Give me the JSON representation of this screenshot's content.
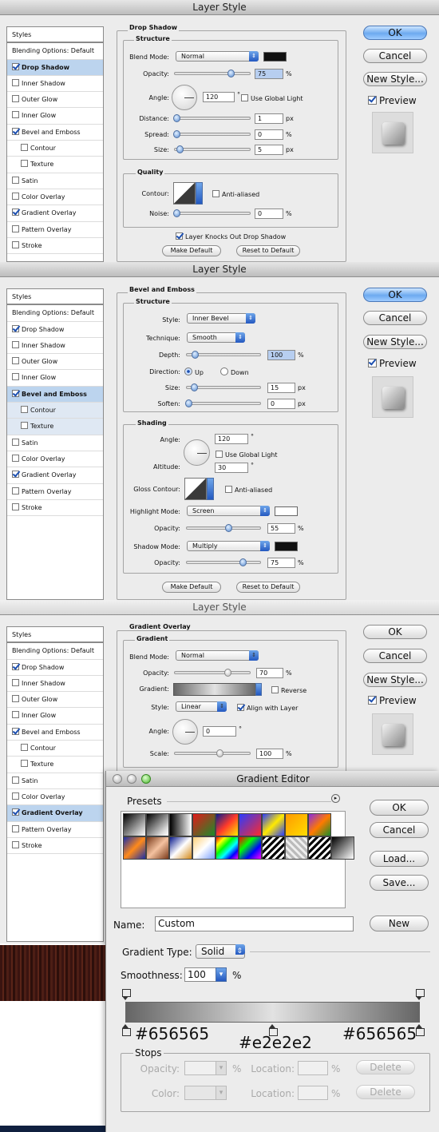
{
  "panel1": {
    "title": "Layer Style",
    "styles_header": "Styles",
    "styles": [
      {
        "label": "Blending Options: Default",
        "check": null,
        "indent": false,
        "state": ""
      },
      {
        "label": "Drop Shadow",
        "check": true,
        "indent": false,
        "state": "sel"
      },
      {
        "label": "Inner Shadow",
        "check": false,
        "indent": false,
        "state": ""
      },
      {
        "label": "Outer Glow",
        "check": false,
        "indent": false,
        "state": ""
      },
      {
        "label": "Inner Glow",
        "check": false,
        "indent": false,
        "state": ""
      },
      {
        "label": "Bevel and Emboss",
        "check": true,
        "indent": false,
        "state": ""
      },
      {
        "label": "Contour",
        "check": false,
        "indent": true,
        "state": ""
      },
      {
        "label": "Texture",
        "check": false,
        "indent": true,
        "state": ""
      },
      {
        "label": "Satin",
        "check": false,
        "indent": false,
        "state": ""
      },
      {
        "label": "Color Overlay",
        "check": false,
        "indent": false,
        "state": ""
      },
      {
        "label": "Gradient Overlay",
        "check": true,
        "indent": false,
        "state": ""
      },
      {
        "label": "Pattern Overlay",
        "check": false,
        "indent": false,
        "state": ""
      },
      {
        "label": "Stroke",
        "check": false,
        "indent": false,
        "state": ""
      }
    ],
    "section_title": "Drop Shadow",
    "structure_title": "Structure",
    "blend_mode_label": "Blend Mode:",
    "blend_mode": "Normal",
    "blend_color": "#111111",
    "opacity_label": "Opacity:",
    "opacity": "75",
    "opacity_unit": "%",
    "angle_label": "Angle:",
    "angle": "120",
    "angle_unit": "°",
    "global_light": "Use Global Light",
    "distance_label": "Distance:",
    "distance": "1",
    "distance_unit": "px",
    "spread_label": "Spread:",
    "spread": "0",
    "spread_unit": "%",
    "size_label": "Size:",
    "size": "5",
    "size_unit": "px",
    "quality_title": "Quality",
    "contour_label": "Contour:",
    "anti_aliased": "Anti-aliased",
    "noise_label": "Noise:",
    "noise": "0",
    "noise_unit": "%",
    "knockout": "Layer Knocks Out Drop Shadow",
    "make_default": "Make Default",
    "reset_default": "Reset to Default",
    "ok": "OK",
    "cancel": "Cancel",
    "new_style": "New Style...",
    "preview": "Preview"
  },
  "panel2": {
    "title": "Layer Style",
    "styles_header": "Styles",
    "styles": [
      {
        "label": "Blending Options: Default",
        "check": null,
        "indent": false,
        "state": ""
      },
      {
        "label": "Drop Shadow",
        "check": true,
        "indent": false,
        "state": ""
      },
      {
        "label": "Inner Shadow",
        "check": false,
        "indent": false,
        "state": ""
      },
      {
        "label": "Outer Glow",
        "check": false,
        "indent": false,
        "state": ""
      },
      {
        "label": "Inner Glow",
        "check": false,
        "indent": false,
        "state": ""
      },
      {
        "label": "Bevel and Emboss",
        "check": true,
        "indent": false,
        "state": "sel"
      },
      {
        "label": "Contour",
        "check": false,
        "indent": true,
        "state": "sel2"
      },
      {
        "label": "Texture",
        "check": false,
        "indent": true,
        "state": "sel2"
      },
      {
        "label": "Satin",
        "check": false,
        "indent": false,
        "state": ""
      },
      {
        "label": "Color Overlay",
        "check": false,
        "indent": false,
        "state": ""
      },
      {
        "label": "Gradient Overlay",
        "check": true,
        "indent": false,
        "state": ""
      },
      {
        "label": "Pattern Overlay",
        "check": false,
        "indent": false,
        "state": ""
      },
      {
        "label": "Stroke",
        "check": false,
        "indent": false,
        "state": ""
      }
    ],
    "section_title": "Bevel and Emboss",
    "structure_title": "Structure",
    "style_label": "Style:",
    "style": "Inner Bevel",
    "technique_label": "Technique:",
    "technique": "Smooth",
    "depth_label": "Depth:",
    "depth": "100",
    "depth_unit": "%",
    "direction_label": "Direction:",
    "up": "Up",
    "down": "Down",
    "size_label": "Size:",
    "size": "15",
    "size_unit": "px",
    "soften_label": "Soften:",
    "soften": "0",
    "soften_unit": "px",
    "shading_title": "Shading",
    "angle_label": "Angle:",
    "angle": "120",
    "angle_unit": "°",
    "global_light": "Use Global Light",
    "altitude_label": "Altitude:",
    "altitude": "30",
    "altitude_unit": "°",
    "gloss_label": "Gloss Contour:",
    "anti_aliased": "Anti-aliased",
    "highlight_label": "Highlight Mode:",
    "highlight_mode": "Screen",
    "highlight_color": "#ffffff",
    "hopacity_label": "Opacity:",
    "hopacity": "55",
    "hopacity_unit": "%",
    "shadow_label": "Shadow Mode:",
    "shadow_mode": "Multiply",
    "shadow_color": "#111111",
    "sopacity_label": "Opacity:",
    "sopacity": "75",
    "sopacity_unit": "%",
    "make_default": "Make Default",
    "reset_default": "Reset to Default",
    "ok": "OK",
    "cancel": "Cancel",
    "new_style": "New Style...",
    "preview": "Preview"
  },
  "panel3": {
    "title": "Layer Style",
    "styles_header": "Styles",
    "styles": [
      {
        "label": "Blending Options: Default",
        "check": null,
        "indent": false,
        "state": ""
      },
      {
        "label": "Drop Shadow",
        "check": true,
        "indent": false,
        "state": ""
      },
      {
        "label": "Inner Shadow",
        "check": false,
        "indent": false,
        "state": ""
      },
      {
        "label": "Outer Glow",
        "check": false,
        "indent": false,
        "state": ""
      },
      {
        "label": "Inner Glow",
        "check": false,
        "indent": false,
        "state": ""
      },
      {
        "label": "Bevel and Emboss",
        "check": true,
        "indent": false,
        "state": ""
      },
      {
        "label": "Contour",
        "check": false,
        "indent": true,
        "state": ""
      },
      {
        "label": "Texture",
        "check": false,
        "indent": true,
        "state": ""
      },
      {
        "label": "Satin",
        "check": false,
        "indent": false,
        "state": ""
      },
      {
        "label": "Color Overlay",
        "check": false,
        "indent": false,
        "state": ""
      },
      {
        "label": "Gradient Overlay",
        "check": true,
        "indent": false,
        "state": "sel"
      },
      {
        "label": "Pattern Overlay",
        "check": false,
        "indent": false,
        "state": ""
      },
      {
        "label": "Stroke",
        "check": false,
        "indent": false,
        "state": ""
      }
    ],
    "section_title": "Gradient Overlay",
    "gradient_title": "Gradient",
    "blend_mode_label": "Blend Mode:",
    "blend_mode": "Normal",
    "opacity_label": "Opacity:",
    "opacity": "70",
    "opacity_unit": "%",
    "gradient_label": "Gradient:",
    "reverse": "Reverse",
    "style_label": "Style:",
    "style": "Linear",
    "align": "Align with Layer",
    "angle_label": "Angle:",
    "angle": "0",
    "angle_unit": "°",
    "scale_label": "Scale:",
    "scale": "100",
    "scale_unit": "%",
    "ok": "OK",
    "cancel": "Cancel",
    "new_style": "New Style...",
    "preview": "Preview"
  },
  "gradient_editor": {
    "title": "Gradient Editor",
    "presets_label": "Presets",
    "ok": "OK",
    "cancel": "Cancel",
    "load": "Load...",
    "save": "Save...",
    "name_label": "Name:",
    "name_value": "Custom",
    "new": "New",
    "type_label": "Gradient Type:",
    "type_value": "Solid",
    "smooth_label": "Smoothness:",
    "smooth_value": "100",
    "smooth_unit": "%",
    "stop_left_color": "#656565",
    "stop_mid_color": "#e2e2e2",
    "stop_right_color": "#656565",
    "stops_title": "Stops",
    "opacity_label": "Opacity:",
    "location_label": "Location:",
    "pct": "%",
    "color_label": "Color:",
    "delete": "Delete"
  },
  "colors": {
    "accent": "#4a8ee0",
    "window_bg": "#ececec"
  }
}
